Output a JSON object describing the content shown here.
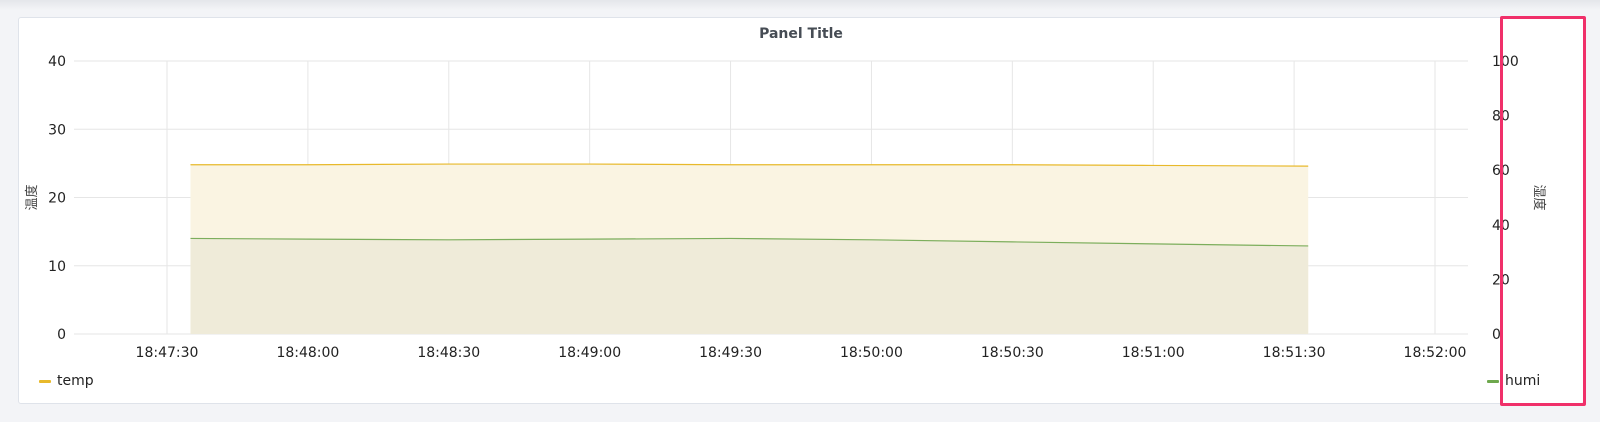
{
  "panel": {
    "title": "Panel Title"
  },
  "legend": [
    {
      "name": "temp",
      "color": "#e8b92b"
    },
    {
      "name": "humi",
      "color": "#6ea84d"
    }
  ],
  "highlight_color": "#f0306a",
  "chart_data": {
    "type": "area",
    "title": "Panel Title",
    "x_ticks": [
      "18:47:30",
      "18:48:00",
      "18:48:30",
      "18:49:00",
      "18:49:30",
      "18:50:00",
      "18:50:30",
      "18:51:00",
      "18:51:30",
      "18:52:00"
    ],
    "x": [
      "18:47:35",
      "18:48:00",
      "18:48:30",
      "18:49:00",
      "18:49:30",
      "18:50:00",
      "18:50:30",
      "18:51:00",
      "18:51:33"
    ],
    "y_left": {
      "label": "温度",
      "range": [
        0,
        40
      ],
      "ticks": [
        0,
        10,
        20,
        30,
        40
      ]
    },
    "y_right": {
      "label": "湿度",
      "range": [
        0,
        100
      ],
      "ticks": [
        0,
        20,
        40,
        60,
        80,
        100
      ]
    },
    "grid": true,
    "legend_position": "bottom",
    "series": [
      {
        "name": "temp",
        "axis": "left",
        "color": "#e8b92b",
        "fill": "#faf4e2",
        "values": [
          24.8,
          24.8,
          24.9,
          24.9,
          24.8,
          24.8,
          24.8,
          24.7,
          24.6
        ]
      },
      {
        "name": "humi",
        "axis": "left",
        "color": "#7cae5c",
        "fill": "#efebd9",
        "values": [
          14.0,
          13.9,
          13.8,
          13.9,
          14.0,
          13.8,
          13.5,
          13.2,
          12.9
        ]
      }
    ]
  }
}
